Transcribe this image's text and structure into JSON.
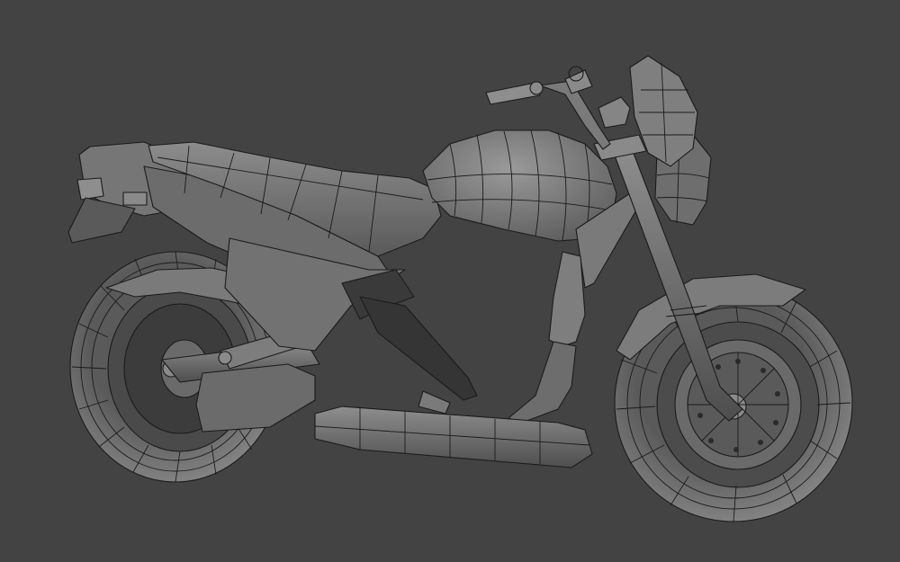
{
  "viewport": {
    "background": "#434343",
    "subject": "motorcycle-wireframe-model"
  },
  "colors": {
    "surface": "#6f6f6f",
    "surface_light": "#8a8a8a",
    "surface_dark": "#555555",
    "shadow": "#2a2a2a",
    "wire": "#1b1b1b"
  }
}
